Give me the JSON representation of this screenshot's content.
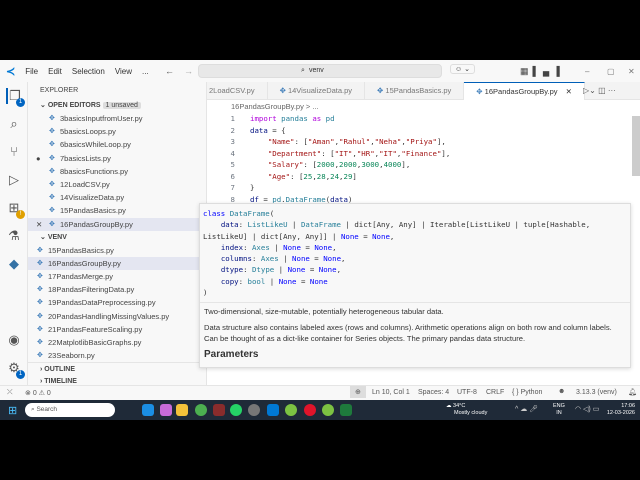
{
  "menu": [
    "File",
    "Edit",
    "Selection",
    "View",
    "..."
  ],
  "search": "venv",
  "explorer": {
    "title": "EXPLORER",
    "open_editors": "OPEN EDITORS",
    "unsaved": "1 unsaved",
    "open_files": [
      "3basicsInputfromUser.py",
      "5basicsLoops.py",
      "6basicsWhileLoop.py",
      "7basicsLists.py",
      "8basicsFunctions.py",
      "12LoadCSV.py",
      "14VisualizeData.py",
      "15PandasBasics.py",
      "16PandasGroupBy.py"
    ],
    "venv": "VENV",
    "venv_files": [
      "15PandasBasics.py",
      "16PandasGroupBy.py",
      "17PandasMerge.py",
      "18PandasFilteringData.py",
      "19PandasDataPreprocessing.py",
      "20PandasHandlingMissingValues.py",
      "21PandasFeatureScaling.py",
      "22MatplotlibBasicGraphs.py",
      "23Seaborn.py"
    ],
    "outline": "OUTLINE",
    "timeline": "TIMELINE"
  },
  "tabs": [
    "2LoadCSV.py",
    "14VisualizeData.py",
    "15PandasBasics.py",
    "16PandasGroupBy.py"
  ],
  "breadcrumb": "16PandasGroupBy.py > ...",
  "code": [
    "<span class='kw'>import</span> <span class='cls'>pandas</span> <span class='kw'>as</span> <span class='cls'>pd</span>",
    "<span class='id'>data</span> = {",
    "    <span class='str'>\"Name\"</span>: [<span class='str'>\"Aman\"</span>,<span class='str'>\"Rahul\"</span>,<span class='str'>\"Neha\"</span>,<span class='str'>\"Priya\"</span>],",
    "    <span class='str'>\"Department\"</span>: [<span class='str'>\"IT\"</span>,<span class='str'>\"HR\"</span>,<span class='str'>\"IT\"</span>,<span class='str'>\"Finance\"</span>],",
    "    <span class='str'>\"Salary\"</span>: [<span class='num'>2000</span>,<span class='num'>2000</span>,<span class='num'>3000</span>,<span class='num'>4000</span>],",
    "    <span class='str'>\"Age\"</span>: [<span class='num'>25</span>,<span class='num'>28</span>,<span class='num'>24</span>,<span class='num'>29</span>]",
    "}",
    "<span class='id'>df</span> = <span class='cls'>pd</span>.<span class='cls'>DataFrame</span>(<span class='id'>data</span>)"
  ],
  "hover": {
    "signature": [
      "<span class='nm'>class</span> <span class='cls'>DataFrame</span>(",
      "    <span class='id'>data</span>: <span class='cls'>ListLikeU</span> | <span class='cls'>DataFrame</span> | dict[Any, Any] | Iterable[ListLikeU | tuple[Hashable,",
      "ListLikeU] | dict[Any, Any]] | <span class='nm'>None</span> = <span class='nm'>None</span>,",
      "    <span class='id'>index</span>: <span class='cls'>Axes</span> | <span class='nm'>None</span> = <span class='nm'>None</span>,",
      "    <span class='id'>columns</span>: <span class='cls'>Axes</span> | <span class='nm'>None</span> = <span class='nm'>None</span>,",
      "    <span class='id'>dtype</span>: <span class='cls'>Dtype</span> | <span class='nm'>None</span> = <span class='nm'>None</span>,",
      "    <span class='id'>copy</span>: <span class='cls'>bool</span> | <span class='nm'>None</span> = <span class='nm'>None</span>",
      ")"
    ],
    "desc1": "Two-dimensional, size-mutable, potentially heterogeneous tabular data.",
    "desc2": "Data structure also contains labeled axes (rows and columns). Arithmetic operations align on both row and column labels. Can be thought of as a dict-like container for Series objects. The primary pandas data structure.",
    "params": "Parameters"
  },
  "status": {
    "errors": "0",
    "warnings": "0",
    "position": "Ln 10, Col 1",
    "spaces": "Spaces: 4",
    "encoding": "UTF-8",
    "eol": "CRLF",
    "lang": "{ } Python",
    "interpreter": "3.13.3 (venv)"
  },
  "taskbar": {
    "search": "Search",
    "weather_temp": "34°C",
    "weather": "Mostly cloudy",
    "lang1": "ENG",
    "lang2": "IN",
    "time": "17:06",
    "date": "12-03-2026"
  }
}
